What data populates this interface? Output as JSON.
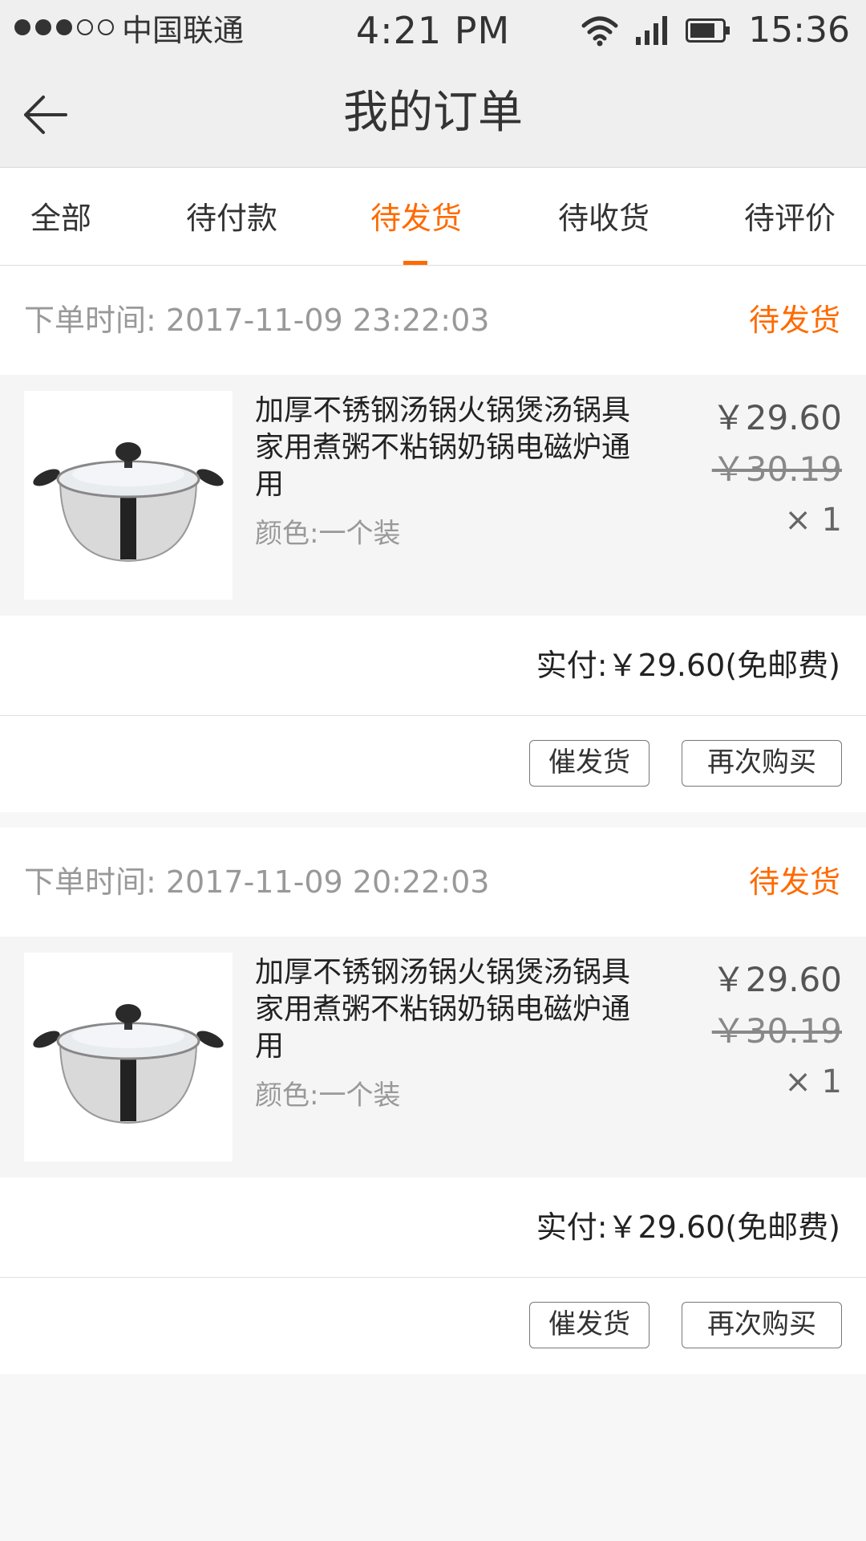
{
  "status_bar": {
    "carrier": "中国联通",
    "time_center": "4:21 PM",
    "time_right": "15:36",
    "signal_dots": {
      "filled": 3,
      "empty": 2
    },
    "icons": [
      "wifi-icon",
      "cell-signal-icon",
      "battery-icon"
    ]
  },
  "header": {
    "title": "我的订单",
    "back_icon": "back-arrow-icon"
  },
  "tabs": {
    "items": [
      {
        "label": "全部"
      },
      {
        "label": "待付款"
      },
      {
        "label": "待发货"
      },
      {
        "label": "待收货"
      },
      {
        "label": "待评价"
      }
    ],
    "active_index": 2
  },
  "orders": [
    {
      "order_time": "下单时间: 2017-11-09  23:22:03",
      "status": "待发货",
      "product": {
        "name": "加厚不锈钢汤锅火锅煲汤锅具家用煮粥不粘锅奶锅电磁炉通用",
        "spec": "颜色:一个装",
        "price": "￥29.60",
        "original_price": "￥30.19",
        "quantity": "× 1"
      },
      "paid": "实付:￥29.60(免邮费)",
      "actions": {
        "urge": "催发货",
        "rebuy": "再次购买"
      }
    },
    {
      "order_time": "下单时间: 2017-11-09  20:22:03",
      "status": "待发货",
      "product": {
        "name": "加厚不锈钢汤锅火锅煲汤锅具家用煮粥不粘锅奶锅电磁炉通用",
        "spec": "颜色:一个装",
        "price": "￥29.60",
        "original_price": "￥30.19",
        "quantity": "× 1"
      },
      "paid": "实付:￥29.60(免邮费)",
      "actions": {
        "urge": "催发货",
        "rebuy": "再次购买"
      }
    }
  ],
  "colors": {
    "accent": "#ff6a00",
    "header_bg": "#efefef",
    "page_bg": "#f7f7f7",
    "product_bg": "#f5f5f5"
  }
}
